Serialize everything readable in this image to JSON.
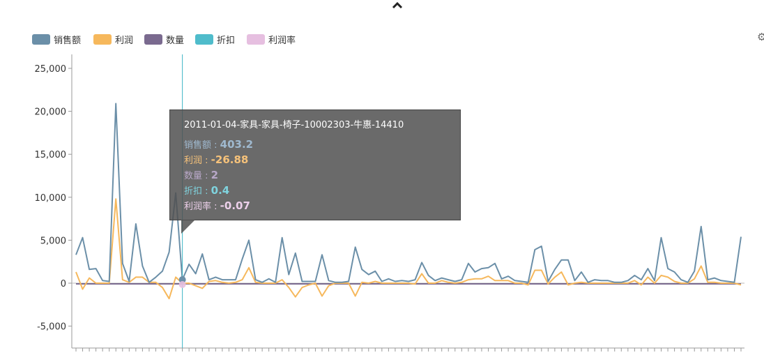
{
  "chart_data": {
    "type": "line",
    "series": [
      {
        "name": "销售额",
        "color": "#6b8fa8",
        "values": [
          3300,
          5300,
          1600,
          1700,
          300,
          200,
          20900,
          2300,
          200,
          6900,
          2000,
          100,
          700,
          1400,
          3600,
          10500,
          403.2,
          2200,
          1100,
          3400,
          400,
          700,
          400,
          400,
          400,
          2800,
          5000,
          400,
          100,
          500,
          100,
          5300,
          1000,
          3500,
          200,
          200,
          200,
          3300,
          300,
          100,
          100,
          200,
          4200,
          1600,
          1000,
          1400,
          200,
          500,
          200,
          300,
          200,
          400,
          2400,
          900,
          300,
          600,
          400,
          200,
          400,
          2300,
          1300,
          1700,
          1800,
          2300,
          500,
          800,
          300,
          200,
          100,
          3900,
          4300,
          200,
          1600,
          2700,
          2700,
          300,
          1300,
          100,
          400,
          300,
          300,
          100,
          100,
          300,
          900,
          400,
          1700,
          300,
          5300,
          1700,
          1300,
          400,
          100,
          1400,
          6600,
          400,
          600,
          300,
          200,
          100,
          5400
        ]
      },
      {
        "name": "利润",
        "color": "#f6b85c",
        "values": [
          1300,
          -700,
          600,
          0,
          0,
          0,
          9800,
          400,
          100,
          700,
          700,
          100,
          100,
          -500,
          -1800,
          700,
          -26.88,
          0,
          -300,
          -600,
          200,
          300,
          100,
          0,
          100,
          400,
          1800,
          100,
          0,
          0,
          0,
          400,
          -500,
          -1600,
          -500,
          -200,
          0,
          -1500,
          -300,
          0,
          0,
          0,
          -1500,
          100,
          0,
          200,
          0,
          0,
          0,
          0,
          0,
          -100,
          1100,
          0,
          0,
          300,
          100,
          0,
          100,
          400,
          500,
          500,
          800,
          300,
          300,
          300,
          0,
          0,
          -200,
          1500,
          1500,
          -100,
          700,
          1300,
          -200,
          0,
          100,
          0,
          0,
          0,
          0,
          0,
          0,
          0,
          300,
          -200,
          700,
          0,
          900,
          700,
          200,
          0,
          0,
          500,
          2000,
          100,
          100,
          0,
          0,
          0,
          -200
        ]
      },
      {
        "name": "数量",
        "color": "#7a6a8f",
        "values": []
      },
      {
        "name": "折扣",
        "color": "#4fbccb",
        "values": []
      },
      {
        "name": "利润率",
        "color": "#e6bfe0",
        "values": []
      }
    ],
    "ylim": [
      -7000,
      27000
    ],
    "yticks": [
      "25,000",
      "20,000",
      "15,000",
      "10,000",
      "5,000",
      "0",
      "-5,000"
    ],
    "ytick_values": [
      25000,
      20000,
      15000,
      10000,
      5000,
      0,
      -5000
    ],
    "highlight_index": 16,
    "legend_position": "top-left",
    "grid": false
  },
  "tooltip": {
    "title": "2011-01-04-家具-家具-椅子-10002303-牛惠-14410",
    "rows": [
      {
        "label": "销售额",
        "value": "403.2",
        "color": "#9fb9cf"
      },
      {
        "label": "利润",
        "value": "-26.88",
        "color": "#f6c27a"
      },
      {
        "label": "数量",
        "value": "2",
        "color": "#b8a8c8"
      },
      {
        "label": "折扣",
        "value": "0.4",
        "color": "#7fd3de"
      },
      {
        "label": "利润率",
        "value": "-0.07",
        "color": "#ecd0ea"
      }
    ]
  },
  "icons": {
    "collapse": "chevron-up-icon",
    "settings": "gear-icon"
  }
}
